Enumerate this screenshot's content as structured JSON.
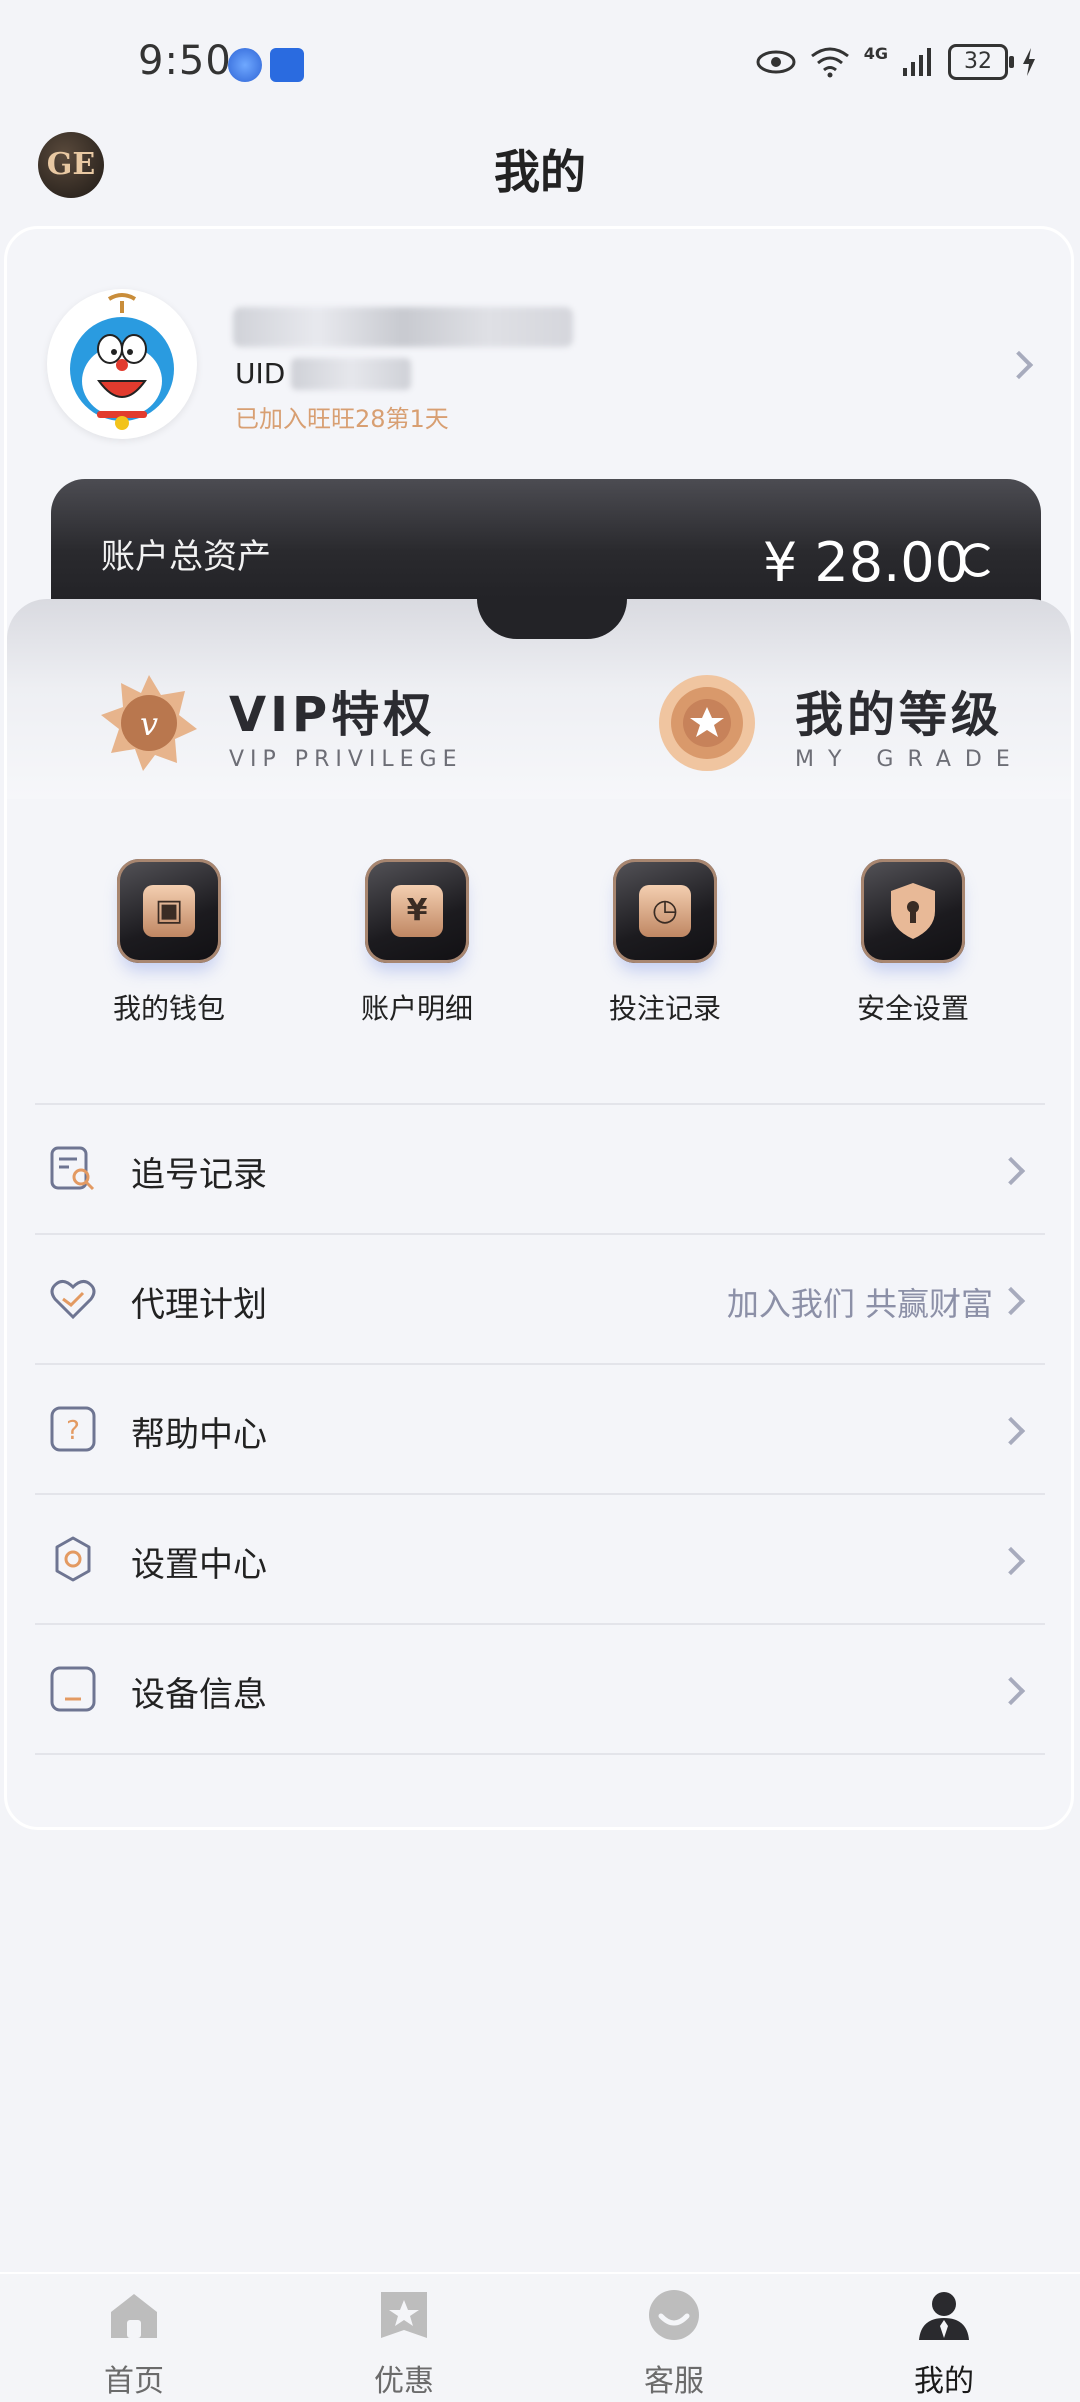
{
  "status_bar": {
    "time": "9:50",
    "network": "4G",
    "battery": "32"
  },
  "header": {
    "title": "我的",
    "logo_text": "GE"
  },
  "profile": {
    "uid_prefix": "UID",
    "joined_text": "已加入旺旺28第1天"
  },
  "assets": {
    "label": "账户总资产",
    "amount": "¥ 28.00"
  },
  "privileges": [
    {
      "title": "VIP特权",
      "subtitle": "VIP PRIVILEGE",
      "icon": "vip-badge-icon"
    },
    {
      "title": "我的等级",
      "subtitle": "MY GRADE",
      "icon": "grade-medal-icon"
    }
  ],
  "quick_actions": [
    {
      "label": "我的钱包",
      "icon": "wallet-icon"
    },
    {
      "label": "账户明细",
      "icon": "yuan-bag-icon"
    },
    {
      "label": "投注记录",
      "icon": "record-clock-icon"
    },
    {
      "label": "安全设置",
      "icon": "shield-lock-icon"
    }
  ],
  "menu": [
    {
      "label": "追号记录",
      "icon": "search-list-icon",
      "extra": ""
    },
    {
      "label": "代理计划",
      "icon": "handshake-heart-icon",
      "extra": "加入我们 共赢财富"
    },
    {
      "label": "帮助中心",
      "icon": "help-question-icon",
      "extra": ""
    },
    {
      "label": "设置中心",
      "icon": "settings-gear-icon",
      "extra": ""
    },
    {
      "label": "设备信息",
      "icon": "device-icon",
      "extra": ""
    }
  ],
  "bottom_nav": [
    {
      "label": "首页",
      "icon": "home-icon",
      "active": false
    },
    {
      "label": "优惠",
      "icon": "coupon-star-icon",
      "active": false
    },
    {
      "label": "客服",
      "icon": "customer-service-icon",
      "active": false
    },
    {
      "label": "我的",
      "icon": "profile-icon",
      "active": true
    }
  ],
  "colors": {
    "accent_copper": "#d89f72",
    "dark_panel": "#1d1d21",
    "muted_text": "#8c90a7"
  }
}
